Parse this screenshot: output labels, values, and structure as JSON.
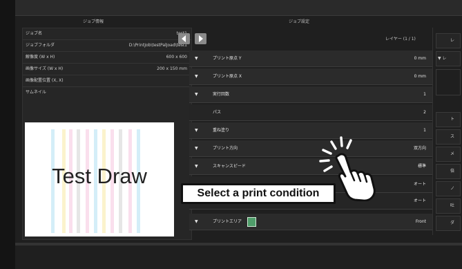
{
  "panels": {
    "job_info_title": "ジョブ情報",
    "job_settings_title": "ジョブ設定"
  },
  "job_info": {
    "rows": [
      {
        "key": "ジョブ名",
        "value": "test1"
      },
      {
        "key": "ジョブフォルダ",
        "value": "D:\\PrintJob\\testPalJoad\\test1"
      },
      {
        "key": "解像度 (W x H)",
        "value": "600 x 600"
      },
      {
        "key": "画像サイズ (W x H)",
        "value": "200 x 150 mm"
      },
      {
        "key": "画像配置位置 (X, X)",
        "value": ""
      },
      {
        "key": "サムネイル",
        "value": ""
      }
    ],
    "thumbnail_text": "Test Draw",
    "stripe_colors": [
      "#f5b7d8",
      "#9fd9ef",
      "#f6e58d",
      "#f5b7d8",
      "#c7c7c7",
      "#f5b7d8",
      "#9fd9ef",
      "#f6e58d",
      "#f5b7d8",
      "#c7c7c7"
    ]
  },
  "layer": {
    "label": "レイヤー (1 / 1)"
  },
  "conditions": [
    {
      "arrow": "▼",
      "label": "プリント原点 Y",
      "value": "0 mm"
    },
    {
      "arrow": "▼",
      "label": "プリント原点 X",
      "value": "0 mm"
    },
    {
      "arrow": "▼",
      "label": "実行回数",
      "value": "1"
    },
    {
      "arrow": "",
      "label": "パス",
      "value": "2"
    },
    {
      "arrow": "▼",
      "label": "重ね塗り",
      "value": "1"
    },
    {
      "arrow": "▼",
      "label": "プリント方向",
      "value": "双方向"
    },
    {
      "arrow": "▼",
      "label": "スキャンスピード",
      "value": "標準"
    },
    {
      "arrow": "",
      "label": "",
      "value": "オート"
    },
    {
      "arrow": "",
      "label": "",
      "value": "オート"
    },
    {
      "arrow": "▼",
      "label": "プリントエリア",
      "value": "Front"
    }
  ],
  "right_panel": {
    "rows": [
      "レ",
      "▼ レ",
      "",
      "ト",
      "ス",
      "メ",
      "倍",
      "ノ",
      "吐",
      "ダ"
    ]
  },
  "callout": {
    "text": "Select a print condition"
  },
  "colors": {
    "accent": "#8a8a8a",
    "background": "#1f1f1f"
  }
}
